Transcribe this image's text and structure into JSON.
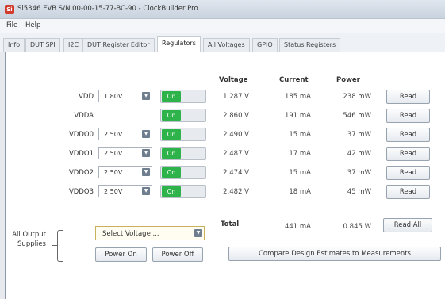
{
  "window": {
    "title": "Si5346 EVB S/N 00-00-15-77-BC-90 - ClockBuilder Pro",
    "icon_text": "Si"
  },
  "menu": [
    "File",
    "Help"
  ],
  "tabs": [
    "Info",
    "DUT SPI",
    "I2C",
    "DUT Register Editor",
    "Regulators",
    "All Voltages",
    "GPIO",
    "Status Registers"
  ],
  "active_tab": "Regulators",
  "headers": {
    "voltage": "Voltage",
    "current": "Current",
    "power": "Power"
  },
  "rows": [
    {
      "name": "VDD",
      "setting": "1.80V",
      "toggle": "On",
      "voltage": "1.287 V",
      "current": "185 mA",
      "power": "238 mW",
      "button": "Read"
    },
    {
      "name": "VDDA",
      "setting": "",
      "toggle": "On",
      "voltage": "2.860 V",
      "current": "191 mA",
      "power": "546 mW",
      "button": "Read"
    },
    {
      "name": "VDDO0",
      "setting": "2.50V",
      "toggle": "On",
      "voltage": "2.490 V",
      "current": "15 mA",
      "power": "37 mW",
      "button": "Read"
    },
    {
      "name": "VDDO1",
      "setting": "2.50V",
      "toggle": "On",
      "voltage": "2.487 V",
      "current": "17 mA",
      "power": "42 mW",
      "button": "Read"
    },
    {
      "name": "VDDO2",
      "setting": "2.50V",
      "toggle": "On",
      "voltage": "2.474 V",
      "current": "15 mA",
      "power": "37 mW",
      "button": "Read"
    },
    {
      "name": "VDDO3",
      "setting": "2.50V",
      "toggle": "On",
      "voltage": "2.482 V",
      "current": "18 mA",
      "power": "45 mW",
      "button": "Read"
    }
  ],
  "totals": {
    "label": "Total",
    "current": "441 mA",
    "power": "0.845 W",
    "button": "Read All"
  },
  "all_output": {
    "label_line1": "All Output",
    "label_line2": "Supplies",
    "select_placeholder": "Select Voltage ...",
    "power_on": "Power On",
    "power_off": "Power Off"
  },
  "compare_button": "Compare Design Estimates to Measurements",
  "colors": {
    "toggle_on": "#2db34a",
    "accent": "#d23a2c"
  }
}
